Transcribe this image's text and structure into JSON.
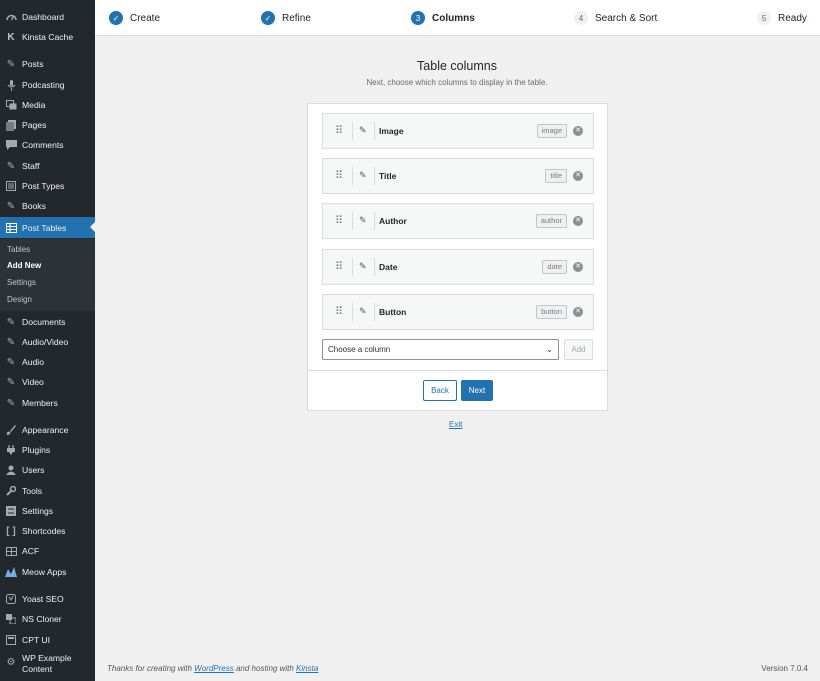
{
  "sidebar": {
    "items": [
      {
        "label": "Dashboard",
        "icon": "dashboard-icon"
      },
      {
        "label": "Kinsta Cache",
        "icon": "kinsta-icon"
      },
      {
        "label": "Posts",
        "icon": "pin-icon"
      },
      {
        "label": "Podcasting",
        "icon": "microphone-icon"
      },
      {
        "label": "Media",
        "icon": "media-icon"
      },
      {
        "label": "Pages",
        "icon": "pages-icon"
      },
      {
        "label": "Comments",
        "icon": "comments-icon"
      },
      {
        "label": "Staff",
        "icon": "pin-icon"
      },
      {
        "label": "Post Types",
        "icon": "post-types-icon"
      },
      {
        "label": "Books",
        "icon": "pin-icon"
      },
      {
        "label": "Post Tables",
        "icon": "table-icon"
      },
      {
        "label": "Documents",
        "icon": "pin-icon"
      },
      {
        "label": "Audio/Video",
        "icon": "pin-icon"
      },
      {
        "label": "Audio",
        "icon": "pin-icon"
      },
      {
        "label": "Video",
        "icon": "pin-icon"
      },
      {
        "label": "Members",
        "icon": "pin-icon"
      },
      {
        "label": "Appearance",
        "icon": "brush-icon"
      },
      {
        "label": "Plugins",
        "icon": "plug-icon"
      },
      {
        "label": "Users",
        "icon": "user-icon"
      },
      {
        "label": "Tools",
        "icon": "wrench-icon"
      },
      {
        "label": "Settings",
        "icon": "settings-icon"
      },
      {
        "label": "Shortcodes",
        "icon": "brackets-icon"
      },
      {
        "label": "ACF",
        "icon": "acf-icon"
      },
      {
        "label": "Meow Apps",
        "icon": "meow-icon"
      },
      {
        "label": "Yoast SEO",
        "icon": "yoast-icon"
      },
      {
        "label": "NS Cloner",
        "icon": "cloner-icon"
      },
      {
        "label": "CPT UI",
        "icon": "cpt-icon"
      },
      {
        "label": "WP Example Content",
        "icon": "gear-icon"
      }
    ],
    "wp_example_line1": "WP Example",
    "wp_example_line2": "Content",
    "submenu": [
      "Tables",
      "Add New",
      "Settings",
      "Design"
    ]
  },
  "steps": [
    {
      "label": "Create",
      "marker": "✓",
      "state": "done"
    },
    {
      "label": "Refine",
      "marker": "✓",
      "state": "done"
    },
    {
      "label": "Columns",
      "marker": "3",
      "state": "current"
    },
    {
      "label": "Search & Sort",
      "marker": "4",
      "state": "todo"
    },
    {
      "label": "Ready",
      "marker": "5",
      "state": "todo"
    }
  ],
  "main": {
    "title": "Table columns",
    "subtitle": "Next, choose which columns to display in the table.",
    "columns": [
      {
        "name": "Image",
        "tag": "image"
      },
      {
        "name": "Title",
        "tag": "title"
      },
      {
        "name": "Author",
        "tag": "author"
      },
      {
        "name": "Date",
        "tag": "date"
      },
      {
        "name": "Button",
        "tag": "button"
      }
    ],
    "select_placeholder": "Choose a column",
    "add_label": "Add",
    "back_label": "Back",
    "next_label": "Next",
    "exit_label": "Exit"
  },
  "footer": {
    "thanks_prefix": "Thanks for creating with",
    "wordpress": "WordPress",
    "hosting_mid": "and hosting with",
    "kinsta": "Kinsta",
    "version": "Version 7.0.4"
  },
  "colors": {
    "accent": "#2271b1",
    "sidebar_bg": "#23282d",
    "page_bg": "#f0f0f1"
  }
}
